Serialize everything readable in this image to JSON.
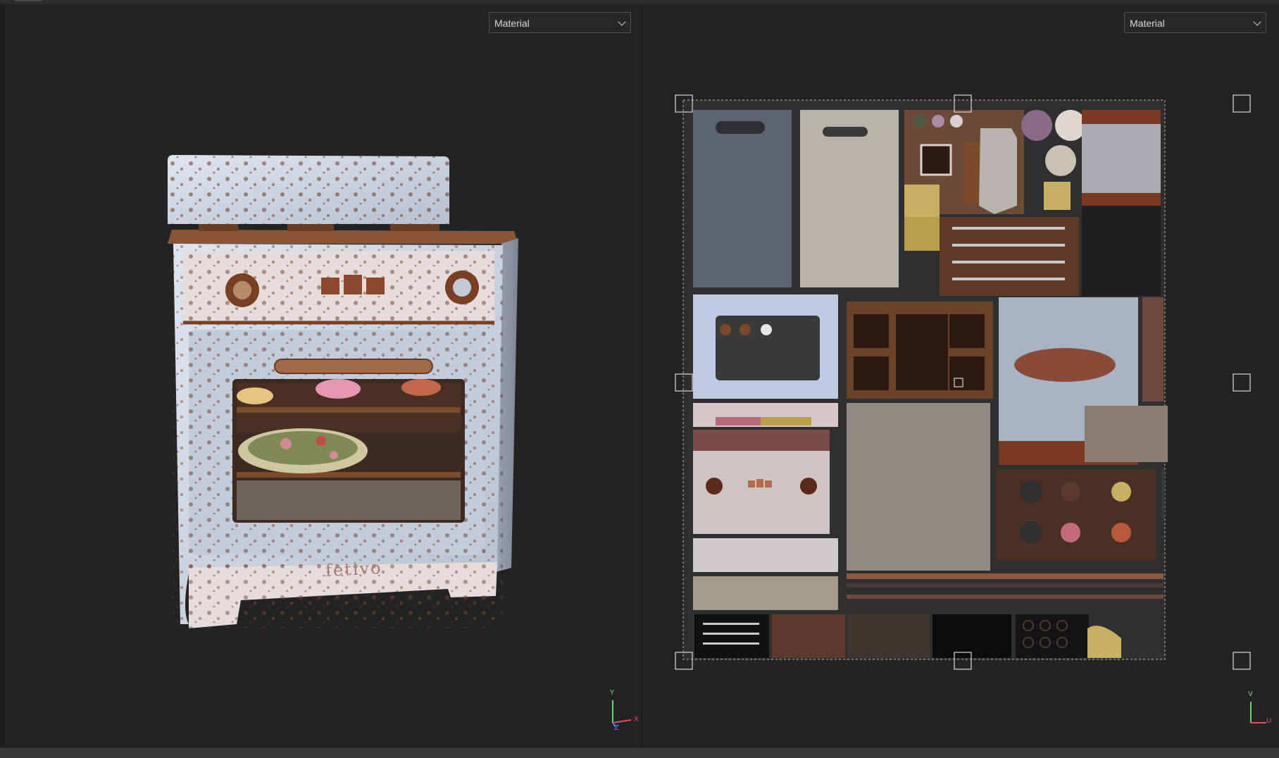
{
  "viewport_3d": {
    "display_mode": "Material",
    "axis": {
      "y": "Y",
      "x": "X",
      "z": "Z"
    }
  },
  "viewport_uv": {
    "display_mode": "Material",
    "axis": {
      "v": "V",
      "u": "U"
    }
  },
  "model": {
    "brand_text": "fetivo"
  },
  "colors": {
    "background": "#232323",
    "axis_x": "#e84a5f",
    "axis_y": "#6cd36c",
    "axis_z": "#5a7cff",
    "paint": "#c9d2e0",
    "rust": "#6b3820"
  }
}
